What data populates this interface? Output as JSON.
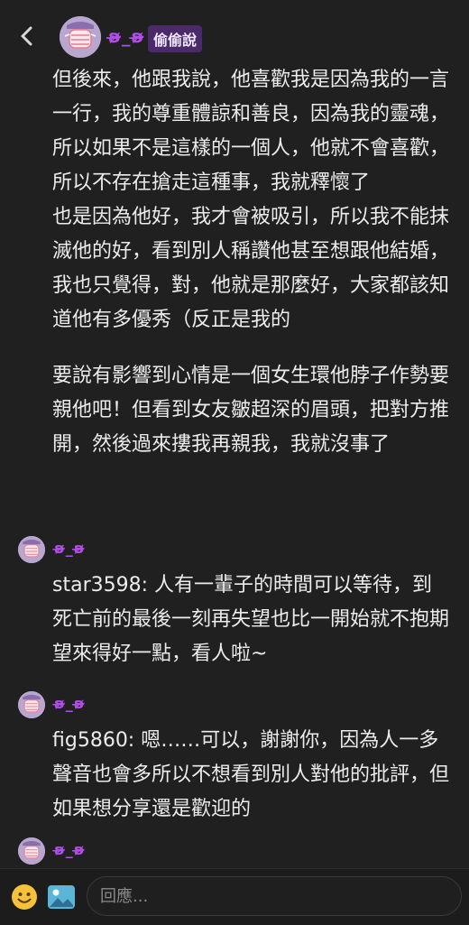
{
  "header": {
    "nickname": "ʚ̴̶̷_ʚ̴̶̷",
    "board_badge": "偷偷說"
  },
  "post": {
    "paragraphs": [
      "但後來，他跟我說，他喜歡我是因為我的一言一行，我的尊重體諒和善良，因為我的靈魂，所以如果不是這樣的一個人，他就不會喜歡，所以不存在搶走這種事，我就釋懷了",
      "也是因為他好，我才會被吸引，所以我不能抹滅他的好，看到別人稱讚他甚至想跟他結婚，我也只覺得，對，他就是那麼好，大家都該知道他有多優秀（反正是我的",
      "要說有影響到心情是一個女生環他脖子作勢要親他吧！但看到女友皺超深的眉頭，把對方推開，然後過來摟我再親我，我就沒事了"
    ]
  },
  "comments": [
    {
      "nickname": "ʚ̴̶̷_ʚ̴̶̷",
      "text": "star3598: 人有一輩子的時間可以等待，到死亡前的最後一刻再失望也比一開始就不抱期望來得好一點，看人啦~"
    },
    {
      "nickname": "ʚ̴̶̷_ʚ̴̶̷",
      "text": "fig5860: 嗯……可以，謝謝你，因為人一多聲音也會多所以不想看到別人對他的批評，但如果想分享還是歡迎的"
    },
    {
      "nickname": "ʚ̴̶̷_ʚ̴̶̷",
      "text": ""
    }
  ],
  "reply_bar": {
    "placeholder": "回應..."
  },
  "colors": {
    "background": "#202020",
    "nickname": "#b04fe8",
    "badge_bg": "#4b2a6a",
    "avatar": "#b8a6cf"
  }
}
